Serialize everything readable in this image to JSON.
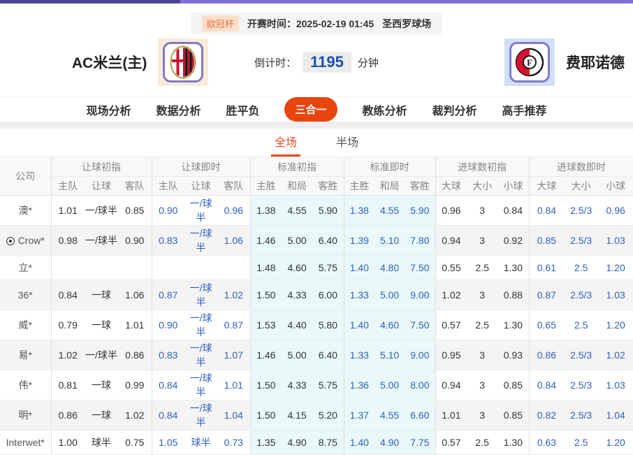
{
  "colors": {
    "accent_orange": "#e8450f",
    "subtab_orange": "#e8491d",
    "live_odds_blue": "#2e5fc0",
    "countdown_blue": "#1a4fb8",
    "standard_col_cyan": "#e9f8f8",
    "topbar_purple_dark": "#4b4397",
    "topbar_purple_light": "#7e72d8",
    "logo_border_purple": "#8478cc"
  },
  "match_header": {
    "league_badge": "欧冠杯",
    "kickoff_label": "开赛时间：",
    "kickoff_time": "2025-02-19 01:45",
    "venue": "圣西罗球场",
    "home_team": "AC米兰(主)",
    "away_team": "费耶诺德",
    "home_logo": "ac-milan-crest",
    "away_logo": "feyenoord-crest",
    "countdown_label": "倒计时：",
    "countdown_value": "1195",
    "countdown_unit": "分钟"
  },
  "nav": {
    "tabs": [
      "现场分析",
      "数据分析",
      "胜平负",
      "三合一",
      "教练分析",
      "裁判分析",
      "高手推荐"
    ],
    "active": "三合一"
  },
  "period_tabs": {
    "full": "全场",
    "half": "半场",
    "active": "全场"
  },
  "odds_table": {
    "company_header": "公司",
    "groups": [
      {
        "title": "让球初指",
        "cols": [
          "主队",
          "让球",
          "客队"
        ],
        "live": false,
        "cyan": false
      },
      {
        "title": "让球即时",
        "cols": [
          "主队",
          "让球",
          "客队"
        ],
        "live": true,
        "cyan": false
      },
      {
        "title": "标准初指",
        "cols": [
          "主胜",
          "和局",
          "客胜"
        ],
        "live": false,
        "cyan": true
      },
      {
        "title": "标准即时",
        "cols": [
          "主胜",
          "和局",
          "客胜"
        ],
        "live": true,
        "cyan": true
      },
      {
        "title": "进球数初指",
        "cols": [
          "大球",
          "大小",
          "小球"
        ],
        "live": false,
        "cyan": false
      },
      {
        "title": "进球数即时",
        "cols": [
          "大球",
          "大小",
          "小球"
        ],
        "live": true,
        "cyan": false
      }
    ],
    "rows": [
      {
        "company": "澳*",
        "icon": null,
        "values": [
          [
            "1.01",
            "一/球半",
            "0.85"
          ],
          [
            "0.90",
            "一/球半",
            "0.96"
          ],
          [
            "1.38",
            "4.55",
            "5.90"
          ],
          [
            "1.38",
            "4.55",
            "5.90"
          ],
          [
            "0.96",
            "3",
            "0.84"
          ],
          [
            "0.84",
            "2.5/3",
            "0.96"
          ]
        ]
      },
      {
        "company": "Crow*",
        "icon": "soccer-ball",
        "values": [
          [
            "0.98",
            "一/球半",
            "0.90"
          ],
          [
            "0.83",
            "一/球半",
            "1.06"
          ],
          [
            "1.46",
            "5.00",
            "6.40"
          ],
          [
            "1.39",
            "5.10",
            "7.80"
          ],
          [
            "0.94",
            "3",
            "0.92"
          ],
          [
            "0.85",
            "2.5/3",
            "1.03"
          ]
        ]
      },
      {
        "company": "立*",
        "icon": null,
        "values": [
          [
            "",
            "",
            ""
          ],
          [
            "",
            "",
            ""
          ],
          [
            "1.48",
            "4.60",
            "5.75"
          ],
          [
            "1.40",
            "4.80",
            "7.50"
          ],
          [
            "0.55",
            "2.5",
            "1.30"
          ],
          [
            "0.61",
            "2.5",
            "1.20"
          ]
        ]
      },
      {
        "company": "36*",
        "icon": null,
        "values": [
          [
            "0.84",
            "一球",
            "1.06"
          ],
          [
            "0.87",
            "一/球半",
            "1.02"
          ],
          [
            "1.50",
            "4.33",
            "6.00"
          ],
          [
            "1.33",
            "5.00",
            "9.00"
          ],
          [
            "1.02",
            "3",
            "0.88"
          ],
          [
            "0.87",
            "2.5/3",
            "1.03"
          ]
        ]
      },
      {
        "company": "威*",
        "icon": null,
        "values": [
          [
            "0.79",
            "一球",
            "1.01"
          ],
          [
            "0.90",
            "一/球半",
            "0.87"
          ],
          [
            "1.53",
            "4.40",
            "5.80"
          ],
          [
            "1.40",
            "4.60",
            "7.50"
          ],
          [
            "0.57",
            "2.5",
            "1.30"
          ],
          [
            "0.65",
            "2.5",
            "1.20"
          ]
        ]
      },
      {
        "company": "易*",
        "icon": null,
        "values": [
          [
            "1.02",
            "一/球半",
            "0.86"
          ],
          [
            "0.83",
            "一/球半",
            "1.07"
          ],
          [
            "1.46",
            "5.00",
            "6.40"
          ],
          [
            "1.33",
            "5.10",
            "9.00"
          ],
          [
            "0.95",
            "3",
            "0.93"
          ],
          [
            "0.86",
            "2.5/3",
            "1.02"
          ]
        ]
      },
      {
        "company": "伟*",
        "icon": null,
        "values": [
          [
            "0.81",
            "一球",
            "0.99"
          ],
          [
            "0.84",
            "一/球半",
            "1.01"
          ],
          [
            "1.50",
            "4.33",
            "5.75"
          ],
          [
            "1.36",
            "5.00",
            "8.00"
          ],
          [
            "0.94",
            "3",
            "0.85"
          ],
          [
            "0.84",
            "2.5/3",
            "1.03"
          ]
        ]
      },
      {
        "company": "明*",
        "icon": null,
        "values": [
          [
            "0.86",
            "一球",
            "1.02"
          ],
          [
            "0.84",
            "一/球半",
            "1.04"
          ],
          [
            "1.50",
            "4.15",
            "5.20"
          ],
          [
            "1.37",
            "4.55",
            "6.60"
          ],
          [
            "1.01",
            "3",
            "0.85"
          ],
          [
            "0.82",
            "2.5/3",
            "1.04"
          ]
        ]
      },
      {
        "company": "Interwet*",
        "icon": null,
        "values": [
          [
            "1.00",
            "球半",
            "0.75"
          ],
          [
            "1.05",
            "球半",
            "0.73"
          ],
          [
            "1.35",
            "4.90",
            "8.75"
          ],
          [
            "1.40",
            "4.90",
            "7.75"
          ],
          [
            "0.57",
            "2.5",
            "1.30"
          ],
          [
            "0.63",
            "2.5",
            "1.20"
          ]
        ]
      }
    ]
  }
}
